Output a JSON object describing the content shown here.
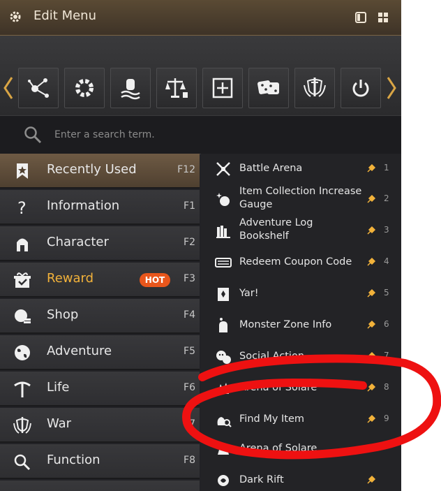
{
  "window": {
    "title": "Edit Menu",
    "title_icon": "gear-icon",
    "buttons": [
      "single-pane-icon",
      "grid-icon"
    ]
  },
  "toolbar": {
    "prev_icon": "chevron-left-icon",
    "next_icon": "chevron-right-icon",
    "buttons": [
      {
        "icon": "constellation-icon"
      },
      {
        "icon": "gear-icon"
      },
      {
        "icon": "hand-wave-icon"
      },
      {
        "icon": "scales-icon"
      },
      {
        "icon": "plus-box-icon"
      },
      {
        "icon": "dice-icon"
      },
      {
        "icon": "shield-sword-icon"
      },
      {
        "icon": "power-icon"
      }
    ]
  },
  "search": {
    "placeholder": "Enter a search term.",
    "icon": "search-icon"
  },
  "categories": [
    {
      "label": "Recently Used",
      "key": "F12",
      "icon": "star-bookmark-icon",
      "active": true
    },
    {
      "label": "Information",
      "key": "F1",
      "icon": "question-icon"
    },
    {
      "label": "Character",
      "key": "F2",
      "icon": "helmet-icon"
    },
    {
      "label": "Reward",
      "key": "F3",
      "icon": "gift-icon",
      "badge": "HOT"
    },
    {
      "label": "Shop",
      "key": "F4",
      "icon": "coins-icon"
    },
    {
      "label": "Adventure",
      "key": "F5",
      "icon": "globe-icon"
    },
    {
      "label": "Life",
      "key": "F6",
      "icon": "pickaxe-icon"
    },
    {
      "label": "War",
      "key": "F7",
      "icon": "shield-sword-icon"
    },
    {
      "label": "Function",
      "key": "F8",
      "icon": "search-icon"
    }
  ],
  "items": [
    {
      "label": "Battle Arena",
      "num": "1",
      "icon": "crossed-swords-icon"
    },
    {
      "label": "Item Collection Increase Gauge",
      "num": "2",
      "icon": "sparkle-icon"
    },
    {
      "label": "Adventure Log Bookshelf",
      "num": "3",
      "icon": "bookshelf-icon"
    },
    {
      "label": "Redeem Coupon Code",
      "num": "4",
      "icon": "coupon-icon"
    },
    {
      "label": "Yar!",
      "num": "5",
      "icon": "card-icon"
    },
    {
      "label": "Monster Zone Info",
      "num": "6",
      "icon": "monster-icon"
    },
    {
      "label": "Social Action",
      "num": "7",
      "icon": "emote-icon"
    },
    {
      "label": "Arena of Solare",
      "num": "8",
      "icon": "arena-icon"
    },
    {
      "label": "Find My Item",
      "num": "9",
      "icon": "bag-search-icon"
    },
    {
      "label": "Arena of Solare",
      "num": "",
      "icon": "arena-icon"
    },
    {
      "label": "Dark Rift",
      "num": "",
      "icon": "rift-icon"
    }
  ],
  "colors": {
    "accent": "#f2b23a",
    "hot_badge": "#e8561c",
    "annotation": "#ee1111"
  }
}
